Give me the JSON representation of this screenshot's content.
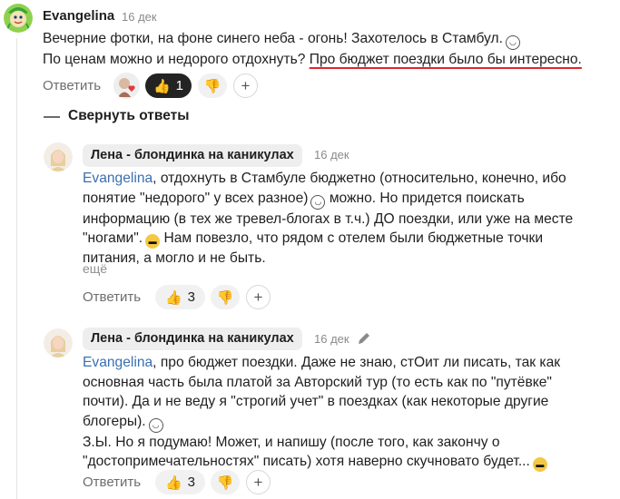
{
  "main_comment": {
    "author": "Evangelina",
    "date": "16 дек",
    "text_lines": [
      "Вечерние фотки, на фоне синего неба - огонь! Захотелось в Стамбул.",
      "По ценам можно и недорого отдохнуть? "
    ],
    "highlight": "Про бюджет поездки было бы интересно.",
    "reply_label": "Ответить",
    "like_count": "1"
  },
  "collapse_label": "Свернуть ответы",
  "reply1": {
    "author": "Лена - блондинка на каникулах",
    "date": "16 дек",
    "mention": "Evangelina",
    "first_line_rest": ", отдохнуть в Стамбуле бюджетно (относительно, конечно, ибо",
    "lines": [
      "понятие \"недорого\" у всех разное)",
      " можно. Но придется поискать",
      "информацию (в тех же тревел-блогах в т.ч.) ДО поездки, или уже на месте",
      "\"ногами\".",
      " Нам повезло, что рядом с отелем были бюджетные точки",
      "питания, а могло и не быть."
    ],
    "more_label": "ещё",
    "reply_label": "Ответить",
    "like_count": "3"
  },
  "reply2": {
    "author": "Лена - блондинка на каникулах",
    "date": "16 дек",
    "mention": "Evangelina",
    "first_line_rest": ", про бюджет поездки. Даже не знаю, стОит ли писать, так как",
    "lines": [
      "основная часть была платой за Авторский тур (то есть как по \"путёвке\"",
      "почти). Да и не веду я \"строгий учет\" в поездках (как некоторые другие",
      "блогеры).",
      "З.Ы. Но я подумаю! Может, и напишу (после того, как закончу о",
      "\"достопримечательностях\" писать) хотя наверно скучновато будет..."
    ],
    "reply_label": "Ответить",
    "like_count": "3"
  },
  "icons": {
    "thumbs_up": "thumbs-up-icon",
    "thumbs_down": "thumbs-down-icon",
    "add": "plus-icon",
    "edit": "pencil-icon",
    "smirk": "smirk-emoji",
    "cool": "sunglasses-emoji"
  },
  "colors": {
    "mention": "#3a6fb0",
    "underline": "#e0252f",
    "like_active_bg": "#232323"
  }
}
